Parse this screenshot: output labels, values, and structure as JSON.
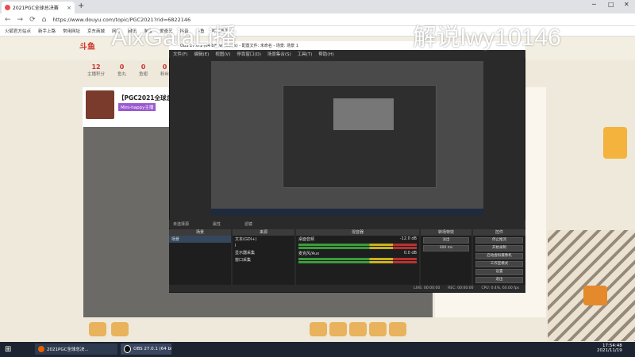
{
  "browser": {
    "tab_title": "2021PGC全球总决赛",
    "url": "https://www.douyu.com/topic/PGC2021?rid=6822146",
    "bookmarks": [
      "火狐官方站点",
      "新手上路",
      "常用网址",
      "京东商城",
      "网易",
      "腾讯",
      "淘宝",
      "爱奇艺",
      "抖音",
      "斗鱼",
      "哔哩哔哩"
    ]
  },
  "watermark": {
    "left": "AixGaiaLi播",
    "right": "解说lwy10146"
  },
  "site": {
    "logo": "斗鱼",
    "stats": [
      {
        "num": "12",
        "label": "主播积分"
      },
      {
        "num": "0",
        "label": "鱼丸"
      },
      {
        "num": "0",
        "label": "鱼翅"
      },
      {
        "num": "0",
        "label": "粉丝"
      }
    ],
    "room_title": "【PGC2021全球总决",
    "room_author": "Mini-happy主播"
  },
  "obs": {
    "title": "OBS 27.0.1 (64 bit, windows) - 配置文件: 未命名 - 场景: 场景 1",
    "menu": [
      "文件(F)",
      "编辑(E)",
      "视图(V)",
      "停靠窗口(D)",
      "场景集合(S)",
      "工具(T)",
      "帮助(H)"
    ],
    "scene_bar": [
      "未选择源",
      "属性",
      "滤镜"
    ],
    "docks": {
      "scenes": "场景",
      "sources": "来源",
      "mixer": "混音器",
      "transitions": "转场特效",
      "controls": "控件"
    },
    "scenes": [
      "场景"
    ],
    "sources": [
      "文本(GDI+)",
      "I",
      "显示器采集",
      "窗口采集"
    ],
    "mixer": [
      {
        "name": "桌面音频",
        "db": "-12.0 dB"
      },
      {
        "name": "麦克风/Aux",
        "db": "0.0 dB"
      }
    ],
    "transition": {
      "type": "淡出",
      "duration": "300 ms"
    },
    "controls": [
      "停止推流",
      "开始录制",
      "启动虚拟摄像机",
      "工作室模式",
      "设置",
      "退出"
    ],
    "status": [
      "LIVE: 00:00:00",
      "REC: 00:00:00",
      "CPU: 0.4%, 60.00 fps"
    ]
  },
  "taskbar": {
    "items": [
      "2021PGC全球总决...",
      "OBS 27.0.1 (64 bi..."
    ],
    "time": "17:54:48",
    "date": "2021/11/19"
  }
}
